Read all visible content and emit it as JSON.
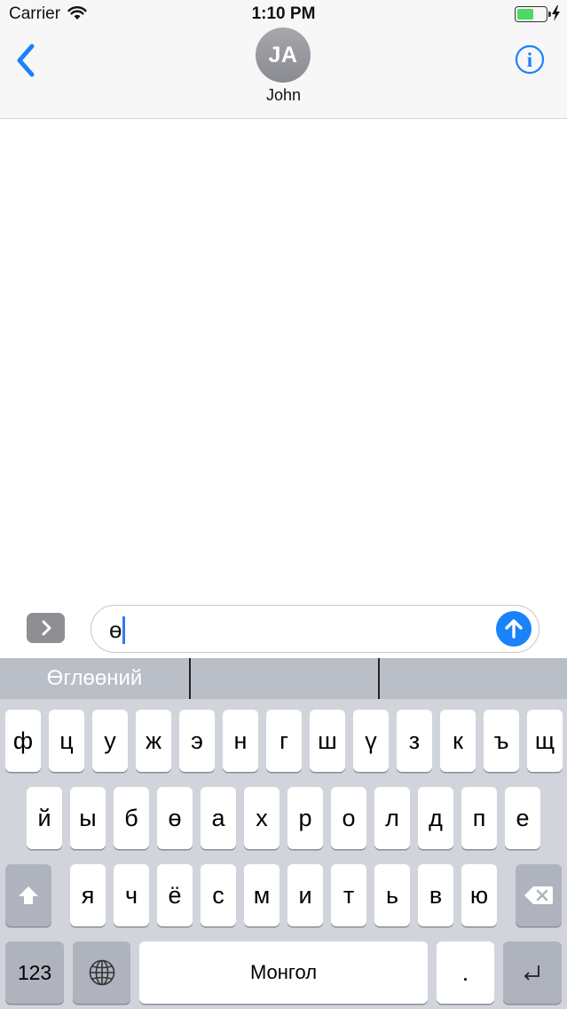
{
  "status": {
    "carrier": "Carrier",
    "time": "1:10 PM",
    "battery_level": 0.6
  },
  "nav": {
    "avatar_initials": "JA",
    "contact_name": "John"
  },
  "composer": {
    "text": "ө"
  },
  "suggestions": [
    "Өглөөний",
    "",
    ""
  ],
  "keyboard": {
    "row1": [
      "ф",
      "ц",
      "у",
      "ж",
      "э",
      "н",
      "г",
      "ш",
      "ү",
      "з",
      "к",
      "ъ",
      "щ"
    ],
    "row2": [
      "й",
      "ы",
      "б",
      "ө",
      "а",
      "х",
      "р",
      "о",
      "л",
      "д",
      "п",
      "е"
    ],
    "row3": [
      "я",
      "ч",
      "ё",
      "с",
      "м",
      "и",
      "т",
      "ь",
      "в",
      "ю"
    ],
    "numbers_label": "123",
    "space_label": "Монгол",
    "period_label": "."
  },
  "colors": {
    "accent": "#1a82fb",
    "keyboard_bg": "#d1d5db",
    "function_key": "#aeb3bd",
    "suggestion_bar": "#b9bec7",
    "battery_fill": "#4cd964"
  },
  "icons": {
    "back": "chevron-left-icon",
    "info": "info-icon",
    "apps": "chevron-right-icon",
    "send": "arrow-up-icon",
    "shift": "shift-icon",
    "delete": "backspace-icon",
    "globe": "globe-icon",
    "return": "return-icon"
  }
}
